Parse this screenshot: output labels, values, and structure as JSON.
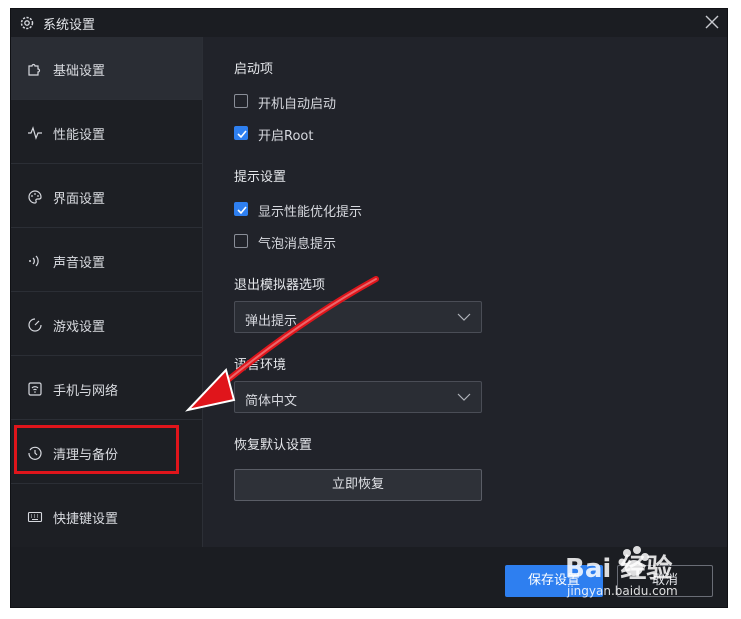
{
  "window": {
    "title": "系统设置"
  },
  "sidebar": {
    "items": [
      {
        "label": "基础设置",
        "icon": "puzzle-icon",
        "active": true
      },
      {
        "label": "性能设置",
        "icon": "pulse-icon",
        "active": false
      },
      {
        "label": "界面设置",
        "icon": "palette-icon",
        "active": false
      },
      {
        "label": "声音设置",
        "icon": "sound-icon",
        "active": false
      },
      {
        "label": "游戏设置",
        "icon": "game-icon",
        "active": false
      },
      {
        "label": "手机与网络",
        "icon": "phone-network-icon",
        "active": false
      },
      {
        "label": "清理与备份",
        "icon": "clock-icon",
        "active": false
      },
      {
        "label": "快捷键设置",
        "icon": "keyboard-icon",
        "active": false
      }
    ]
  },
  "content": {
    "startup": {
      "title": "启动项",
      "options": [
        {
          "label": "开机自动启动",
          "checked": false
        },
        {
          "label": "开启Root",
          "checked": true
        }
      ]
    },
    "notifications": {
      "title": "提示设置",
      "options": [
        {
          "label": "显示性能优化提示",
          "checked": true
        },
        {
          "label": "气泡消息提示",
          "checked": false
        }
      ]
    },
    "exit_option": {
      "title": "退出模拟器选项",
      "value": "弹出提示"
    },
    "language": {
      "title": "语言环境",
      "value": "简体中文"
    },
    "restore": {
      "title": "恢复默认设置",
      "button_label": "立即恢复"
    }
  },
  "footer": {
    "save_label": "保存设置",
    "cancel_label": "取消"
  },
  "watermark": {
    "brand": "Bai  经验",
    "url": "jingyan.baidu.com"
  },
  "colors": {
    "accent": "#2e7ff0",
    "annotation": "#e0151b",
    "background": "#21232a"
  }
}
